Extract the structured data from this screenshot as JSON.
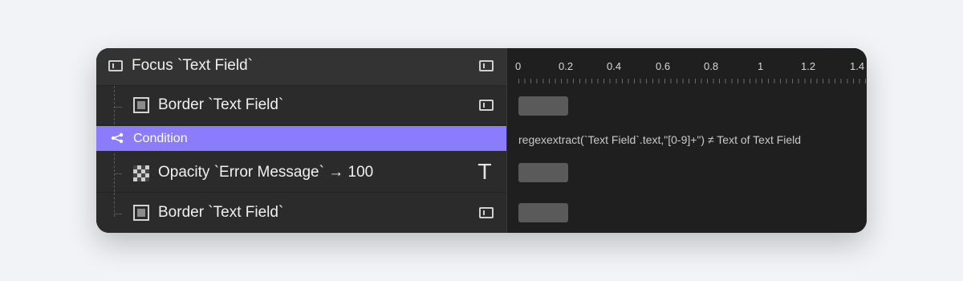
{
  "rows": {
    "header": {
      "label": "Focus `Text Field`"
    },
    "border_1": {
      "label": "Border `Text Field`"
    },
    "condition": {
      "label": "Condition",
      "color": "#8a7cfb"
    },
    "opacity": {
      "label": "Opacity `Error Message` → 100"
    },
    "border_2": {
      "label": "Border `Text Field`"
    }
  },
  "timeline": {
    "ticks": [
      "0",
      "0.2",
      "0.4",
      "0.6",
      "0.8",
      "1",
      "1.2",
      "1.4"
    ],
    "condition_expression": "regexextract(`Text Field`.text,\"[0-9]+\") ≠ Text of Text Field"
  },
  "icons": {
    "header_leading": "frame-icon",
    "header_trailing": "frame-icon",
    "border": "border-icon",
    "opacity": "checkerboard-icon",
    "condition": "share-icon",
    "text_target": "text-icon"
  }
}
